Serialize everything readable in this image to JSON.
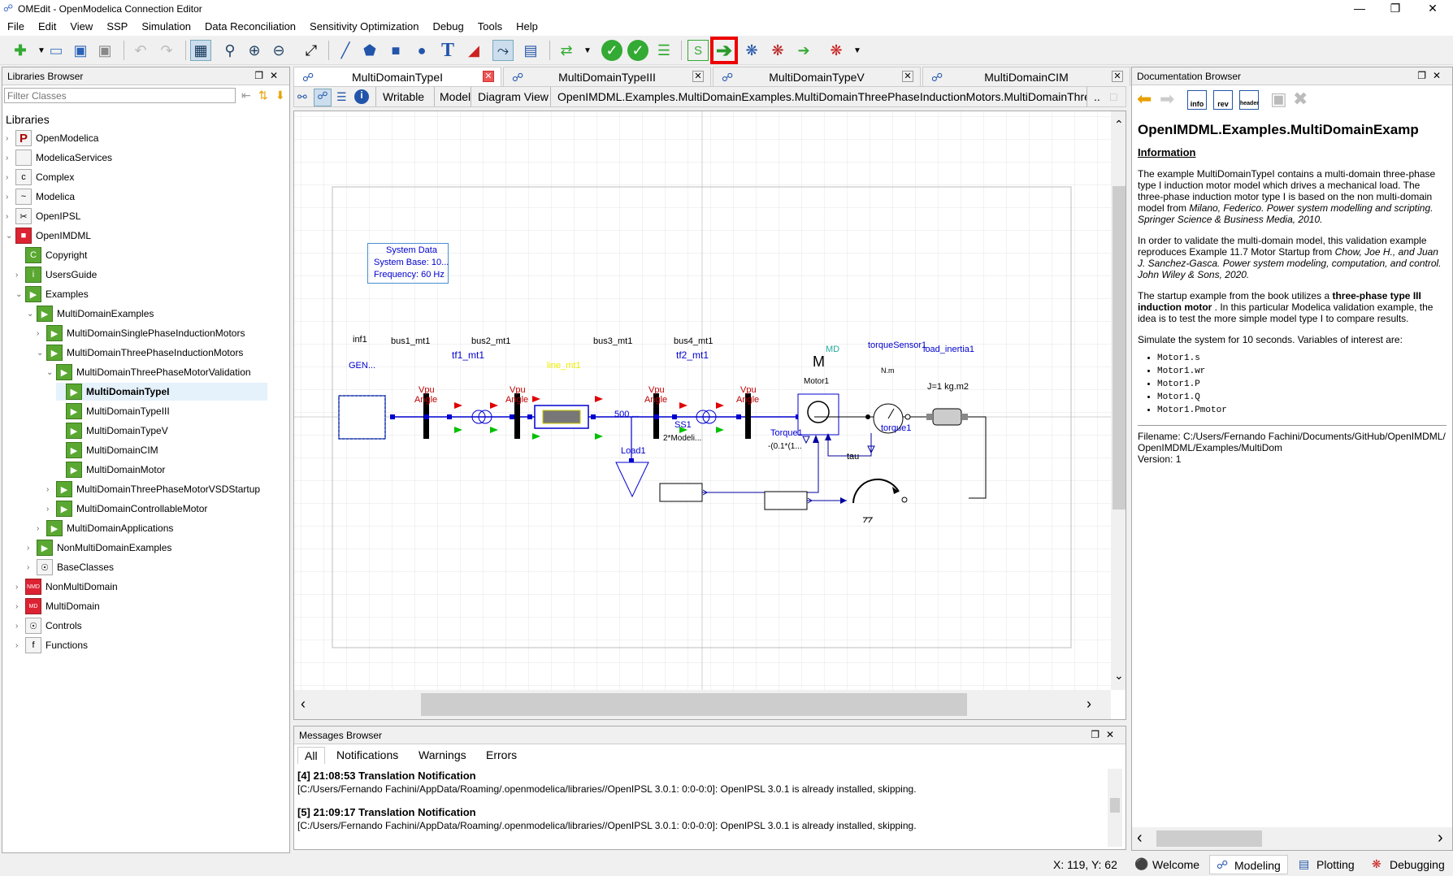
{
  "window": {
    "title": "OMEdit - OpenModelica Connection Editor",
    "min": "—",
    "max": "❐",
    "close": "✕"
  },
  "menu": [
    "File",
    "Edit",
    "View",
    "SSP",
    "Simulation",
    "Data Reconciliation",
    "Sensitivity Optimization",
    "Debug",
    "Tools",
    "Help"
  ],
  "libraries": {
    "title": "Libraries Browser",
    "filter_placeholder": "Filter Classes",
    "root_label": "Libraries",
    "items": [
      {
        "label": "OpenModelica",
        "depth": 0,
        "arrow": "›",
        "icon": "P"
      },
      {
        "label": "ModelicaServices",
        "depth": 0,
        "arrow": "›",
        "icon": ""
      },
      {
        "label": "Complex",
        "depth": 0,
        "arrow": "›",
        "icon": "c"
      },
      {
        "label": "Modelica",
        "depth": 0,
        "arrow": "›",
        "icon": "~"
      },
      {
        "label": "OpenIPSL",
        "depth": 0,
        "arrow": "›",
        "icon": "✂"
      },
      {
        "label": "OpenIMDML",
        "depth": 0,
        "arrow": "⌄",
        "icon": "■"
      },
      {
        "label": "Copyright",
        "depth": 1,
        "arrow": "",
        "icon": "C"
      },
      {
        "label": "UsersGuide",
        "depth": 1,
        "arrow": "›",
        "icon": "i"
      },
      {
        "label": "Examples",
        "depth": 1,
        "arrow": "⌄",
        "icon": "▶"
      },
      {
        "label": "MultiDomainExamples",
        "depth": 2,
        "arrow": "⌄",
        "icon": "▶"
      },
      {
        "label": "MultiDomainSinglePhaseInductionMotors",
        "depth": 3,
        "arrow": "›",
        "icon": "▶"
      },
      {
        "label": "MultiDomainThreePhaseInductionMotors",
        "depth": 3,
        "arrow": "⌄",
        "icon": "▶"
      },
      {
        "label": "MultiDomainThreePhaseMotorValidation",
        "depth": 4,
        "arrow": "⌄",
        "icon": "▶"
      },
      {
        "label": "MultiDomainTypeI",
        "depth": 5,
        "arrow": "",
        "icon": "▶"
      },
      {
        "label": "MultiDomainTypeIII",
        "depth": 5,
        "arrow": "",
        "icon": "▶"
      },
      {
        "label": "MultiDomainTypeV",
        "depth": 5,
        "arrow": "",
        "icon": "▶"
      },
      {
        "label": "MultiDomainCIM",
        "depth": 5,
        "arrow": "",
        "icon": "▶"
      },
      {
        "label": "MultiDomainMotor",
        "depth": 5,
        "arrow": "",
        "icon": "▶"
      },
      {
        "label": "MultiDomainThreePhaseMotorVSDStartup",
        "depth": 4,
        "arrow": "›",
        "icon": "▶"
      },
      {
        "label": "MultiDomainControllableMotor",
        "depth": 4,
        "arrow": "›",
        "icon": "▶"
      },
      {
        "label": "MultiDomainApplications",
        "depth": 3,
        "arrow": "›",
        "icon": "▶"
      },
      {
        "label": "NonMultiDomainExamples",
        "depth": 2,
        "arrow": "›",
        "icon": "▶"
      },
      {
        "label": "BaseClasses",
        "depth": 2,
        "arrow": "›",
        "icon": "☉"
      },
      {
        "label": "NonMultiDomain",
        "depth": 1,
        "arrow": "›",
        "icon": "NMD"
      },
      {
        "label": "MultiDomain",
        "depth": 1,
        "arrow": "›",
        "icon": "MD"
      },
      {
        "label": "Controls",
        "depth": 1,
        "arrow": "›",
        "icon": "☉"
      },
      {
        "label": "Functions",
        "depth": 1,
        "arrow": "›",
        "icon": "f"
      }
    ]
  },
  "tabs": [
    {
      "label": "MultiDomainTypeI",
      "active": true
    },
    {
      "label": "MultiDomainTypeIII",
      "active": false
    },
    {
      "label": "MultiDomainTypeV",
      "active": false
    },
    {
      "label": "MultiDomainCIM",
      "active": false
    }
  ],
  "editor_toolbar": {
    "writable": "Writable",
    "model": "Model",
    "view": "Diagram View",
    "path": "OpenIMDML.Examples.MultiDomainExamples.MultiDomainThreePhaseInductionMotors.MultiDomainThreePl",
    "more": ".."
  },
  "diagram": {
    "system_data": [
      "System Data",
      "System Base: 10...",
      "Frequency: 60 Hz"
    ],
    "inf1": "inf1",
    "gen": "GEN...",
    "bus1": "bus1_mt1",
    "bus2": "bus2_mt1",
    "bus3": "bus3_mt1",
    "bus4": "bus4_mt1",
    "vpu": "Vpu",
    "angle": "Angle",
    "tf1": "tf1_mt1",
    "tf2": "tf2_mt1",
    "line": "line_mt1",
    "load_value": "500 ...",
    "load_name": "Load1",
    "md": "MD",
    "motor_symbol": "M",
    "motor_name": "Motor1",
    "torque_sensor": "torqueSensor1",
    "nm": "N.m",
    "load_inertia": "load_inertia1",
    "inertia_value": "J=1 kg.m2",
    "ss1": "SS1",
    "ss1_value": "2*Modeli...",
    "torque1_src": "Torque1",
    "torque1_value": "-(0.1*(1...",
    "torque1": "torque1",
    "tau": "tau"
  },
  "messages": {
    "title": "Messages Browser",
    "tabs": [
      "All",
      "Notifications",
      "Warnings",
      "Errors"
    ],
    "entries": [
      {
        "head": "[4] 21:08:53 Translation Notification",
        "body": "[C:/Users/Fernando Fachini/AppData/Roaming/.openmodelica/libraries//OpenIPSL 3.0.1: 0:0-0:0]: OpenIPSL 3.0.1 is already installed, skipping."
      },
      {
        "head": "[5] 21:09:17 Translation Notification",
        "body": "[C:/Users/Fernando Fachini/AppData/Roaming/.openmodelica/libraries//OpenIPSL 3.0.1: 0:0-0:0]: OpenIPSL 3.0.1 is already installed, skipping."
      }
    ]
  },
  "doc": {
    "title": "Documentation Browser",
    "heading": "OpenIMDML.Examples.MultiDomainExamp",
    "info": "Information",
    "p1a": "The example MultiDomainTypeI contains a multi-domain three-phase type I induction motor model which drives a mechanical load. The three-phase induction motor type I is based on the non multi-domain model from ",
    "p1b": "Milano, Federico. Power system modelling and scripting. Springer Science & Business Media, 2010.",
    "p2a": "In order to validate the multi-domain model, this validation example reproduces Example 11.7 Motor Startup from ",
    "p2b": "Chow, Joe H., and Juan J. Sanchez-Gasca. Power system modeling, computation, and control. John Wiley & Sons, 2020.",
    "p3a": "The startup example from the book utilizes a ",
    "p3b": "three-phase type III induction motor",
    "p3c": " . In this particular Modelica validation example, the idea is to test the more simple model type I to compare results.",
    "p4": "Simulate the system for 10 seconds. Variables of interest are:",
    "vars": [
      "Motor1.s",
      "Motor1.wr",
      "Motor1.P",
      "Motor1.Q",
      "Motor1.Pmotor"
    ],
    "filename": "Filename: C:/Users/Fernando Fachini/Documents/GitHub/OpenIMDML/OpenIMDML/Examples/MultiDom",
    "version": "Version: 1",
    "btn_info": "info",
    "btn_rev": "rev",
    "btn_header": "header"
  },
  "status": {
    "coords": "X: 119, Y: 62",
    "perspectives": [
      "Welcome",
      "Modeling",
      "Plotting",
      "Debugging"
    ]
  }
}
